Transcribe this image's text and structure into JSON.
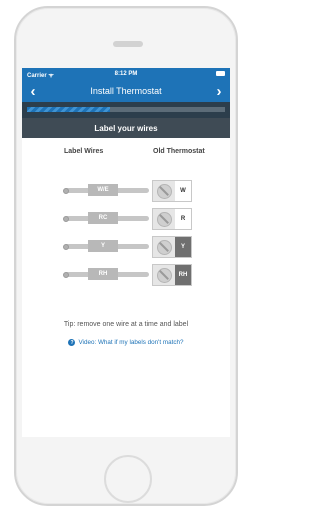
{
  "status_bar": {
    "carrier": "Carrier ᯤ",
    "time": "8:12 PM"
  },
  "nav": {
    "title": "Install Thermostat",
    "back_icon": "‹",
    "forward_icon": "›"
  },
  "progress": {
    "fraction": 0.42
  },
  "section": {
    "title": "Label your wires"
  },
  "columns": {
    "label_wires": "Label Wires",
    "old_thermostat": "Old Thermostat"
  },
  "wires": [
    {
      "tag": "W/E",
      "terminal": "W",
      "dark": false
    },
    {
      "tag": "RC",
      "terminal": "R",
      "dark": false
    },
    {
      "tag": "Y",
      "terminal": "Y",
      "dark": true
    },
    {
      "tag": "RH",
      "terminal": "RH",
      "dark": true
    }
  ],
  "tip": "Tip: remove one wire at a time and label",
  "video": {
    "icon": "?",
    "text": "Video: What if my labels don't match?"
  },
  "colors": {
    "brand_blue": "#1e73b7",
    "header_dark": "#3f4b55"
  }
}
